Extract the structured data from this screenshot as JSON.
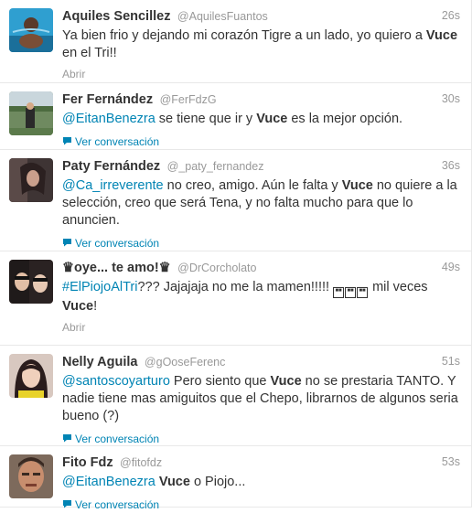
{
  "tweets": [
    {
      "fullname": "Aquiles Sencillez",
      "username": "@AquilesFuantos",
      "time": "26s",
      "parts": [
        "Ya bien frio y dejando mi corazón Tigre a un lado, yo quiero a ",
        "Vuce",
        " en el Tri!!"
      ],
      "action": "Abrir"
    },
    {
      "fullname": "Fer Fernández",
      "username": "@FerFdzG",
      "time": "30s",
      "parts": [
        "@EitanBenezra",
        " se tiene que ir y ",
        "Vuce",
        " es la mejor opción."
      ],
      "action": "Ver conversación"
    },
    {
      "fullname": "Paty Fernández",
      "username": "@_paty_fernandez",
      "time": "36s",
      "parts": [
        "@Ca_irreverente",
        " no creo, amigo. Aún le falta y ",
        "Vuce",
        " no quiere a la selección, creo que será Tena, y no falta mucho para que lo anuncien."
      ],
      "action": "Ver conversación"
    },
    {
      "fullname": "♛oye... te amo!♛",
      "username": "@DrCorcholato",
      "time": "49s",
      "parts": [
        "#ElPiojoAlTri",
        "??? Jajajaja no me la mamen!!!!! ",
        " mil veces ",
        "Vuce",
        "!"
      ],
      "action": "Abrir"
    },
    {
      "fullname": "Nelly Aguila",
      "username": "@gOoseFerenc",
      "time": "51s",
      "parts": [
        "@santoscoyarturo",
        " Pero siento que ",
        "Vuce",
        " no se prestaria TANTO. Y nadie tiene mas amiguitos que el Chepo, librarnos de algunos seria bueno (?)"
      ],
      "action": "Ver conversación"
    },
    {
      "fullname": "Fito Fdz",
      "username": "@fitofdz",
      "time": "53s",
      "parts": [
        "@EitanBenezra",
        " ",
        "Vuce",
        " o Piojo..."
      ],
      "action": "Ver conversación"
    }
  ],
  "colors": {
    "link": "#0084b4",
    "meta": "#999999",
    "text": "#333333",
    "divider": "#e8e8e8"
  },
  "icons": {
    "conversation": "speech-bubble-icon",
    "missing_glyph": "missing-glyph-box-icon"
  }
}
